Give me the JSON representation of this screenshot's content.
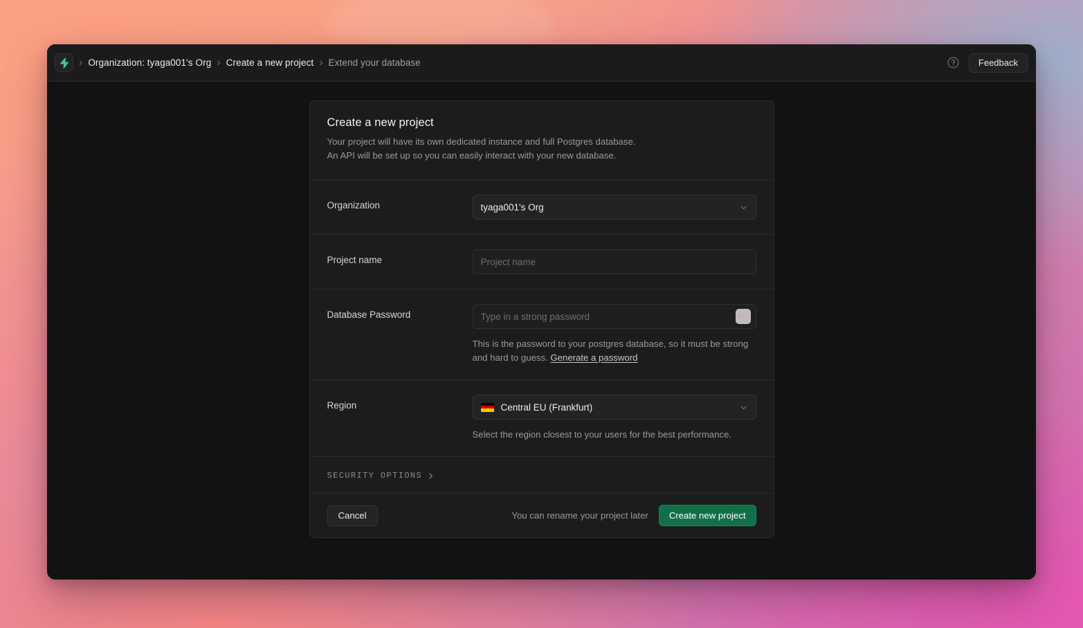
{
  "window": {
    "topbar": {
      "logo_icon": "lightning-bolt-icon",
      "breadcrumbs": [
        {
          "label": "Organization: tyaga001's Org",
          "muted": false
        },
        {
          "label": "Create a new project",
          "muted": false
        },
        {
          "label": "Extend your database",
          "muted": true
        }
      ],
      "separator": "›",
      "help_icon": "question-mark-circle-icon",
      "feedback_label": "Feedback"
    }
  },
  "card": {
    "title": "Create a new project",
    "subtitle_line1": "Your project will have its own dedicated instance and full Postgres database.",
    "subtitle_line2": "An API will be set up so you can easily interact with your new database.",
    "organization": {
      "label": "Organization",
      "selected": "tyaga001's Org",
      "chevron_icon": "chevron-down-icon"
    },
    "project_name": {
      "label": "Project name",
      "value": "",
      "placeholder": "Project name"
    },
    "database_password": {
      "label": "Database Password",
      "value": "",
      "placeholder": "Type in a strong password",
      "toggle_icon": "password-reveal-icon",
      "help_text": "This is the password to your postgres database, so it must be strong and hard to guess. ",
      "generate_link": "Generate a password"
    },
    "region": {
      "label": "Region",
      "selected": "Central EU (Frankfurt)",
      "flag_icon": "germany-flag-icon",
      "flag_colors": [
        "#000000",
        "#dd0000",
        "#ffce00"
      ],
      "chevron_icon": "chevron-down-icon",
      "help_text": "Select the region closest to your users for the best performance."
    },
    "security_options": {
      "label": "SECURITY OPTIONS",
      "chevron_icon": "chevron-right-icon"
    },
    "footer": {
      "cancel_label": "Cancel",
      "note": "You can rename your project later",
      "create_label": "Create new project"
    }
  },
  "colors": {
    "accent_green": "#11704a",
    "logo_green": "#3ecf8e",
    "window_bg": "#121212",
    "card_bg": "#1c1c1c",
    "border": "#2b2b2b"
  }
}
